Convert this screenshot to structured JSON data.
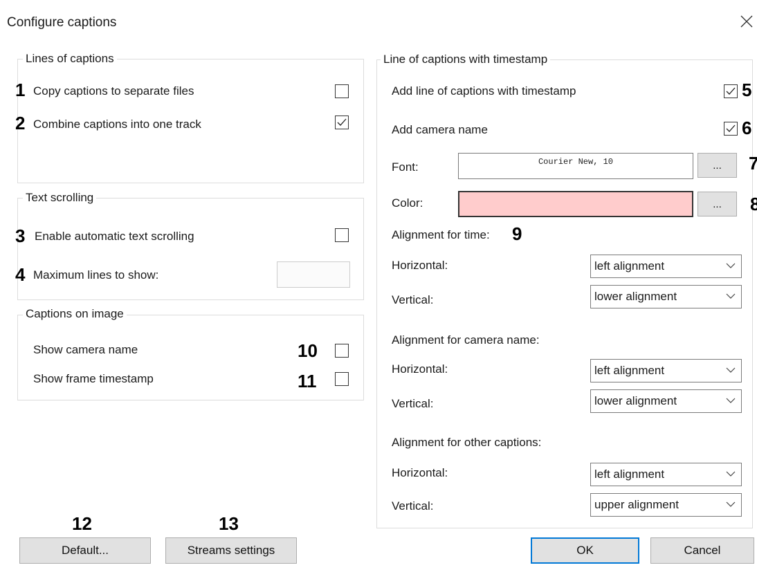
{
  "window": {
    "title": "Configure captions",
    "close_icon": "close-icon"
  },
  "lines_group": {
    "legend": "Lines of captions",
    "copy_label": "Copy captions to separate files",
    "copy_checked": false,
    "copy_num": "1",
    "combine_label": "Combine captions into one track",
    "combine_checked": true,
    "combine_num": "2"
  },
  "scroll_group": {
    "legend": "Text scrolling",
    "auto_label": "Enable automatic text scrolling",
    "auto_checked": false,
    "auto_num": "3",
    "max_label": "Maximum lines to show:",
    "max_value": "",
    "max_num": "4"
  },
  "image_group": {
    "legend": "Captions on image",
    "camera_label": "Show camera name",
    "camera_checked": false,
    "camera_num": "10",
    "timestamp_label": "Show frame timestamp",
    "timestamp_checked": false,
    "timestamp_num": "11"
  },
  "ts_group": {
    "legend": "Line of captions with timestamp",
    "add_line_label": "Add line of captions with timestamp",
    "add_line_checked": true,
    "add_line_num": "5",
    "add_camera_label": "Add camera name",
    "add_camera_checked": true,
    "add_camera_num": "6",
    "font_label": "Font:",
    "font_value": "Courier New, 10",
    "font_num": "7",
    "font_browse": "...",
    "color_label": "Color:",
    "color_value": "#ffcccc",
    "color_num": "8",
    "color_browse": "...",
    "align_time_label": "Alignment for time:",
    "align_time_num": "9",
    "time_h_label": "Horizontal:",
    "time_h_value": "left alignment",
    "time_v_label": "Vertical:",
    "time_v_value": "lower alignment",
    "align_cam_label": "Alignment for camera name:",
    "cam_h_label": "Horizontal:",
    "cam_h_value": "left alignment",
    "cam_v_label": "Vertical:",
    "cam_v_value": "lower alignment",
    "align_other_label": "Alignment for other captions:",
    "other_h_label": "Horizontal:",
    "other_h_value": "left alignment",
    "other_v_label": "Vertical:",
    "other_v_value": "upper alignment"
  },
  "footer": {
    "default_label": "Default...",
    "default_num": "12",
    "streams_label": "Streams settings",
    "streams_num": "13",
    "ok_label": "OK",
    "cancel_label": "Cancel"
  },
  "colors": {
    "accent": "#0078d7",
    "swatch": "#ffcccc"
  }
}
